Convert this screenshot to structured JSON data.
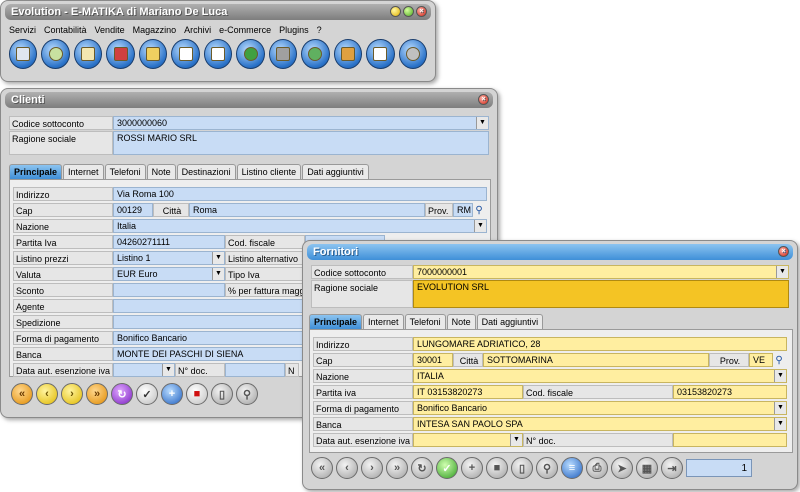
{
  "main_window": {
    "title": "Evolution - E-MATIKA di Mariano De Luca",
    "menu": [
      "Servizi",
      "Contabilità",
      "Vendite",
      "Magazzino",
      "Archivi",
      "e-Commerce",
      "Plugins",
      "?"
    ],
    "toolbar_icons": [
      "floppy-icon",
      "database-icon",
      "clipboard-icon",
      "book-icon",
      "folder-icon",
      "calendar-icon",
      "document-icon",
      "shapes-icon",
      "truck-icon",
      "globe-icon",
      "package-icon",
      "chart-icon",
      "tools-icon"
    ]
  },
  "clienti": {
    "title": "Clienti",
    "codice_sottoconto_label": "Codice sottoconto",
    "codice_sottoconto": "3000000060",
    "ragione_sociale_label": "Ragione sociale",
    "ragione_sociale": "ROSSI MARIO SRL",
    "tabs": [
      "Principale",
      "Internet",
      "Telefoni",
      "Note",
      "Destinazioni",
      "Listino cliente",
      "Dati aggiuntivi"
    ],
    "fields": {
      "indirizzo_label": "Indirizzo",
      "indirizzo": "Via Roma 100",
      "cap_label": "Cap",
      "cap": "00129",
      "citta_label": "Città",
      "citta": "Roma",
      "prov_label": "Prov.",
      "prov": "RM",
      "nazione_label": "Nazione",
      "nazione": "Italia",
      "partita_iva_label": "Partita Iva",
      "partita_iva": "04260271111",
      "cod_fiscale_label": "Cod. fiscale",
      "listino_prezzi_label": "Listino prezzi",
      "listino_prezzi": "Listino 1",
      "listino_alternativo_label": "Listino alternativo",
      "valuta_label": "Valuta",
      "valuta": "EUR Euro",
      "tipo_iva_label": "Tipo Iva",
      "sconto_label": "Sconto",
      "perc_fattura_label": "% per fattura magg",
      "agente_label": "Agente",
      "spedizione_label": "Spedizione",
      "forma_pagamento_label": "Forma di pagamento",
      "forma_pagamento": "Bonifico Bancario",
      "banca_label": "Banca",
      "banca": "MONTE DEI PASCHI DI SIENA",
      "data_esenzione_label": "Data aut. esenzione iva",
      "n_doc_label": "N° doc.",
      "n_trunc_label": "N"
    }
  },
  "fornitori": {
    "title": "Fornitori",
    "codice_sottoconto_label": "Codice sottoconto",
    "codice_sottoconto": "7000000001",
    "ragione_sociale_label": "Ragione sociale",
    "ragione_sociale": "EVOLUTION SRL",
    "tabs": [
      "Principale",
      "Internet",
      "Telefoni",
      "Note",
      "Dati aggiuntivi"
    ],
    "fields": {
      "indirizzo_label": "Indirizzo",
      "indirizzo": "LUNGOMARE ADRIATICO, 28",
      "cap_label": "Cap",
      "cap": "30001",
      "citta_label": "Città",
      "citta": "SOTTOMARINA",
      "prov_label": "Prov.",
      "prov": "VE",
      "nazione_label": "Nazione",
      "nazione": "ITALIA",
      "partita_iva_label": "Partita iva",
      "partita_iva": "IT  03153820273",
      "cod_fiscale_label": "Cod. fiscale",
      "cod_fiscale": "03153820273",
      "forma_pagamento_label": "Forma di pagamento",
      "forma_pagamento": "Bonifico Bancario",
      "banca_label": "Banca",
      "banca": "INTESA SAN PAOLO SPA",
      "data_esenzione_label": "Data aut. esenzione iva",
      "n_doc_label": "N° doc."
    },
    "record_counter": "1"
  }
}
